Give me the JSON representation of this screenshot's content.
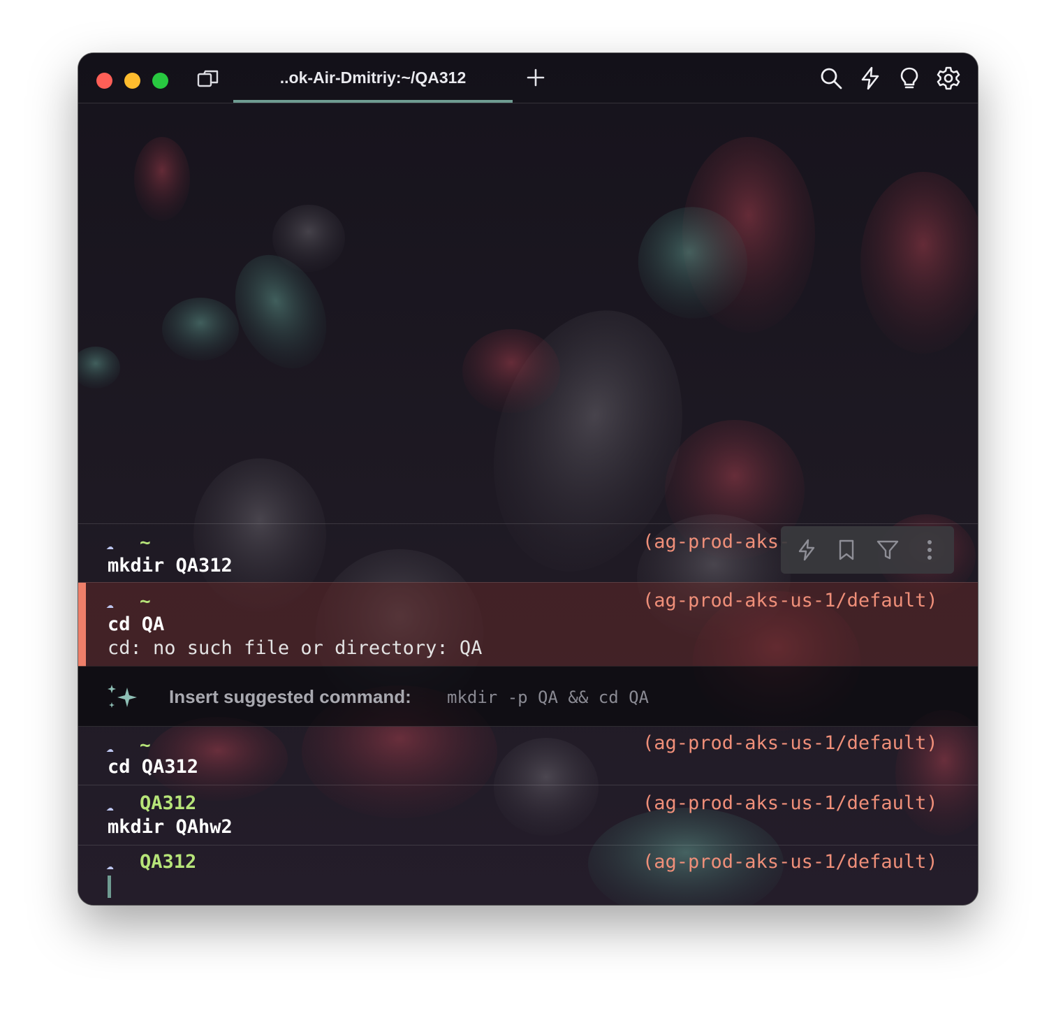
{
  "window": {
    "tab_title": "..ok-Air-Dmitriy:~/QA312"
  },
  "titlebar": {
    "icons": [
      "panes-icon",
      "plus-icon",
      "search-icon",
      "lightning-icon",
      "lightbulb-icon",
      "gear-icon"
    ]
  },
  "blocks": [
    {
      "prompt_symbol": "☁",
      "dir": "~",
      "command": "mkdir QA312",
      "context": "(ag-prod-aks-",
      "output": ""
    },
    {
      "prompt_symbol": "☁",
      "dir": "~",
      "command": "cd QA",
      "context": "(ag-prod-aks-us-1/default)",
      "output": "cd: no such file or directory: QA",
      "status": "error"
    },
    {
      "prompt_symbol": "☁",
      "dir": "~",
      "command": "cd QA312",
      "context": "(ag-prod-aks-us-1/default)",
      "output": ""
    },
    {
      "prompt_symbol": "☁",
      "dir": "QA312",
      "command": "mkdir QAhw2",
      "context": "(ag-prod-aks-us-1/default)",
      "output": ""
    },
    {
      "prompt_symbol": "☁",
      "dir": "QA312",
      "command": "",
      "context": "(ag-prod-aks-us-1/default)",
      "output": ""
    }
  ],
  "suggestion": {
    "label": "Insert suggested command:",
    "command": "mkdir -p QA && cd QA",
    "icon": "sparkle-icon"
  },
  "block_toolbar": {
    "icons": [
      "lightning-icon",
      "bookmark-icon",
      "filter-icon",
      "more-vertical-icon"
    ]
  },
  "colors": {
    "accent": "#6f9c92",
    "error_bar": "#ee7f6a",
    "directory": "#b7e579",
    "context": "#ef8f79",
    "prompt_symbol": "#bfc8f2"
  }
}
